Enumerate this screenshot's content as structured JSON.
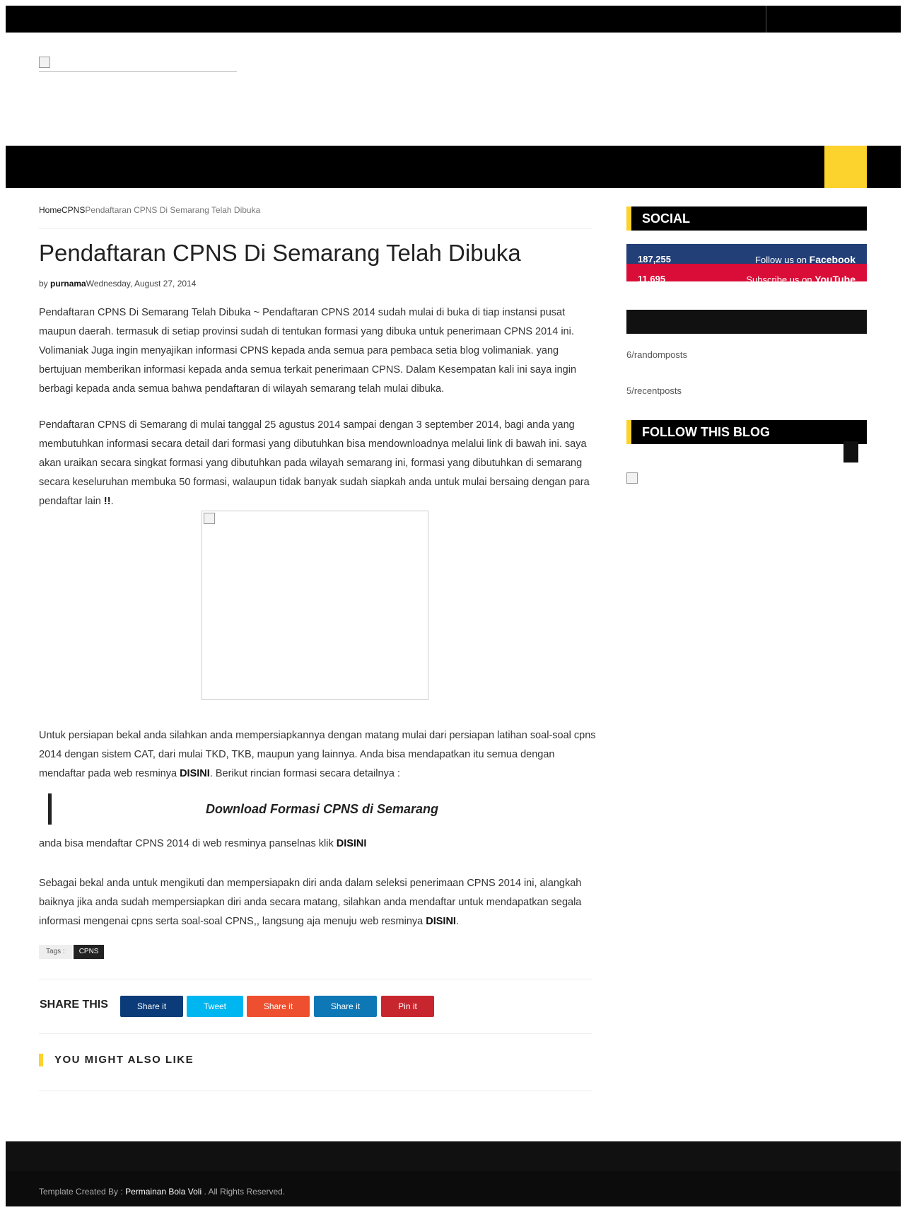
{
  "breadcrumb": {
    "home": "Home",
    "category": "CPNS",
    "current": "Pendaftaran CPNS Di Semarang Telah Dibuka"
  },
  "post": {
    "title": "Pendaftaran CPNS Di Semarang Telah Dibuka",
    "by": "by",
    "author": "purnama",
    "date": "Wednesday, August 27, 2014",
    "p1": "Pendaftaran CPNS Di Semarang Telah Dibuka ~ Pendaftaran CPNS 2014 sudah mulai di buka di tiap instansi pusat maupun daerah. termasuk di setiap provinsi sudah di tentukan formasi yang dibuka untuk penerimaan CPNS 2014 ini. Volimaniak Juga ingin menyajikan informasi CPNS kepada anda semua para pembaca setia blog volimaniak. yang bertujuan memberikan informasi kepada anda semua terkait penerimaan CPNS. Dalam Kesempatan kali ini saya ingin berbagi kepada anda semua bahwa pendaftaran di wilayah semarang telah mulai dibuka.",
    "p2_text": "Pendaftaran CPNS di Semarang di mulai tanggal 25 agustus 2014 sampai dengan 3 september 2014, bagi anda yang membutuhkan informasi secara detail dari formasi yang dibutuhkan bisa mendownloadnya melalui link di bawah ini. saya akan uraikan secara singkat formasi yang dibutuhkan pada wilayah semarang ini, formasi yang dibutuhkan di semarang secara keseluruhan membuka 50 formasi, walaupun tidak banyak sudah siapkah anda untuk mulai bersaing dengan para pendaftar lain ",
    "p2_emph": "!!",
    "p2_end": ".",
    "p3_text": "Untuk persiapan bekal anda silahkan anda mempersiapkannya dengan matang mulai dari persiapan latihan soal-soal cpns 2014 dengan sistem CAT, dari mulai TKD, TKB, maupun yang lainnya. Anda bisa mendapatkan itu semua dengan mendaftar pada web resminya ",
    "p3_link": "DISINI",
    "p3_end": ".  Berikut rincian formasi secara detailnya :",
    "quote": "Download Formasi CPNS di Semarang",
    "p4_text": " anda bisa mendaftar CPNS 2014 di web resminya panselnas klik ",
    "p4_link": "DISINI",
    "p5_text": "Sebagai bekal anda untuk mengikuti dan mempersiapakn diri anda dalam seleksi penerimaan CPNS 2014 ini, alangkah baiknya jika anda sudah mempersiapkan diri anda secara matang, silahkan anda mendaftar untuk mendapatkan segala informasi mengenai cpns serta soal-soal CPNS,, langsung aja menuju web resminya ",
    "p5_link": "DISINI",
    "p5_end": "."
  },
  "tags": {
    "label": "Tags :",
    "items": [
      "CPNS"
    ]
  },
  "share": {
    "label": "SHARE THIS",
    "buttons": [
      {
        "label": "Share it",
        "color": "#0b3b78"
      },
      {
        "label": "Tweet",
        "color": "#00b6f1"
      },
      {
        "label": "Share it",
        "color": "#ee4f2f"
      },
      {
        "label": "Share it",
        "color": "#0e77b5"
      },
      {
        "label": "Pin it",
        "color": "#c8262f"
      }
    ]
  },
  "related": {
    "heading": "YOU MIGHT ALSO LIKE"
  },
  "sidebar": {
    "social_heading": "SOCIAL",
    "facebook": {
      "count": "187,255",
      "text": "Follow us on ",
      "network": "Facebook",
      "color": "#233f77"
    },
    "youtube": {
      "count": "11,695",
      "text": "Subscribe us on ",
      "network": "YouTube",
      "color": "#d90d37"
    },
    "random_posts": "6/randomposts",
    "recent_posts": "5/recentposts",
    "follow_heading": "FOLLOW THIS BLOG"
  },
  "footer": {
    "prefix": "Template Created By : ",
    "author": "Permainan Bola Voli",
    "suffix": " . All Rights Reserved."
  },
  "colors": {
    "accent": "#fcd22c",
    "dark": "#000000"
  }
}
